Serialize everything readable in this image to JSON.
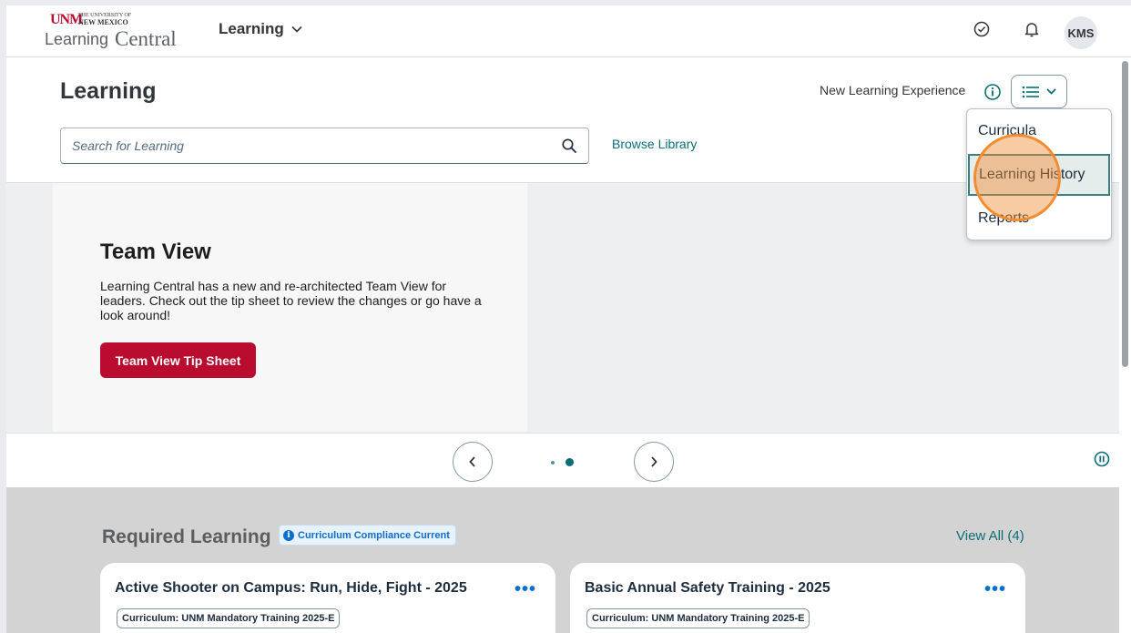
{
  "header": {
    "logo": {
      "org_small": "THE UNIVERSITY OF",
      "org_name": "NEW MEXICO",
      "mark": "UNM",
      "brand_part1": "Learning",
      "brand_part2": "Central",
      "color": "#ba0c2f"
    },
    "menu_label": "Learning",
    "icons": [
      "checkmark-circle-icon",
      "bell-icon"
    ],
    "avatar_initials": "KMS"
  },
  "page": {
    "title": "Learning",
    "experience_label": "New Learning Experience",
    "search_placeholder": "Search for Learning",
    "browse_label": "Browse Library"
  },
  "view_menu": {
    "items": [
      {
        "label": "Curricula",
        "selected": false
      },
      {
        "label": "Learning History",
        "selected": true
      },
      {
        "label": "Reports",
        "selected": false
      }
    ]
  },
  "carousel": {
    "slide_title": "Team View",
    "slide_text": "Learning Central has a new and re-architected Team View for leaders. Check out the tip sheet to review the changes or go have a look around!",
    "button_label": "Team View Tip Sheet",
    "page_count": 2,
    "active_page": 2
  },
  "required": {
    "title": "Required Learning",
    "badge": "Curriculum Compliance Current",
    "view_all": "View All (4)",
    "cards": [
      {
        "title": "Active Shooter on Campus: Run, Hide, Fight - 2025",
        "tag": "Curriculum: UNM Mandatory Training 2025-E"
      },
      {
        "title": "Basic Annual Safety Training - 2025",
        "tag": "Curriculum: UNM Mandatory Training 2025-E"
      }
    ]
  },
  "colors": {
    "brand_red": "#ba0c2f",
    "teal_link": "#0a6e79",
    "sap_blue": "#0a6ed1",
    "highlight_orange": "#f28c30"
  }
}
